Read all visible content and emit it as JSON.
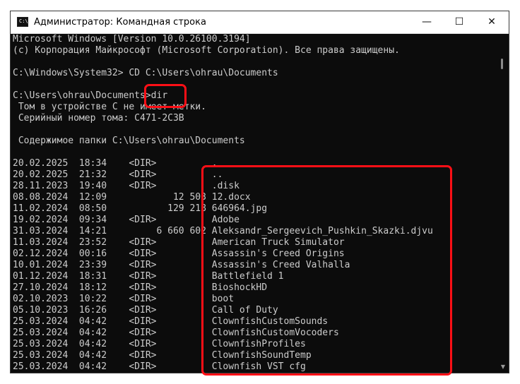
{
  "window": {
    "title": "Администратор: Командная строка",
    "icon": "cmd-icon",
    "icon_glyph": "C:\\",
    "controls": {
      "minimize": "—",
      "maximize": "☐",
      "close": "✕"
    }
  },
  "terminal": {
    "lines": [
      "Microsoft Windows [Version 10.0.26100.3194]",
      "(c) Корпорация Майкрософт (Microsoft Corporation). Все права защищены.",
      "",
      "C:\\Windows\\System32> CD C:\\Users\\ohrau\\Documents",
      "",
      "C:\\Users\\ohrau\\Documents>dir",
      " Том в устройстве C не имеет метки.",
      " Серийный номер тома: C471-2C3B",
      "",
      " Содержимое папки C:\\Users\\ohrau\\Documents",
      "",
      "20.02.2025  18:34    <DIR>          .",
      "20.02.2025  21:32    <DIR>          ..",
      "28.11.2023  19:40    <DIR>          .disk",
      "08.08.2024  12:09            12 503 12.docx",
      "11.02.2024  08:50           129 218 646964.jpg",
      "19.02.2024  09:34    <DIR>          Adobe",
      "31.03.2024  14:21         6 660 602 Aleksandr_Sergeevich_Pushkin_Skazki.djvu",
      "11.03.2024  23:52    <DIR>          American Truck Simulator",
      "02.12.2024  00:16    <DIR>          Assassin's Creed Origins",
      "10.01.2024  23:39    <DIR>          Assassin's Creed Valhalla",
      "01.12.2024  18:31    <DIR>          Battlefield 1",
      "27.10.2024  18:12    <DIR>          BioshockHD",
      "02.10.2023  10:22    <DIR>          boot",
      "05.10.2023  16:26    <DIR>          Call of Duty",
      "25.03.2024  04:42    <DIR>          ClownfishCustomSounds",
      "25.03.2024  04:42    <DIR>          ClownfishCustomVocoders",
      "25.03.2024  04:42    <DIR>          ClownfishProfiles",
      "25.03.2024  04:42    <DIR>          ClownfishSoundTemp",
      "25.03.2024  04:42    <DIR>          Clownfish VST cfg"
    ]
  },
  "highlight_color": "#ff0f16"
}
